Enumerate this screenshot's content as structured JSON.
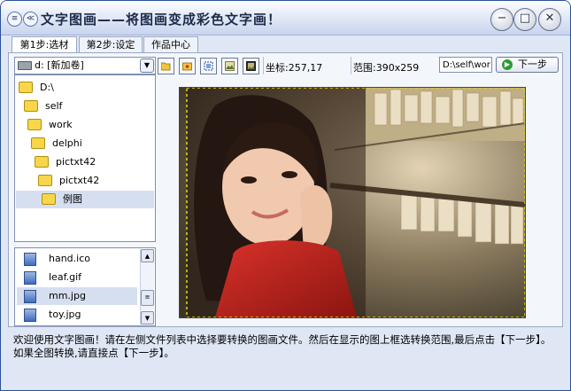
{
  "window": {
    "title": "文字图画——将图画变成彩色文字画！",
    "menu_icon": "≡",
    "collapse_icon": "≪",
    "minimize_icon": "−",
    "maximize_icon": "□",
    "close_icon": "✕"
  },
  "tabs": [
    {
      "label": "第1步:选材",
      "active": true
    },
    {
      "label": "第2步:设定",
      "active": false
    },
    {
      "label": "作品中心",
      "active": false
    }
  ],
  "drive": {
    "label": "d: [新加卷]",
    "dropdown_icon": "chevron-down-icon"
  },
  "tree": [
    {
      "label": "D:\\"
    },
    {
      "label": "self"
    },
    {
      "label": "work"
    },
    {
      "label": "delphi"
    },
    {
      "label": "pictxt42"
    },
    {
      "label": "pictxt42"
    },
    {
      "label": "例图",
      "selected": true
    }
  ],
  "files": [
    {
      "label": "hand.ico"
    },
    {
      "label": "leaf.gif"
    },
    {
      "label": "mm.jpg",
      "selected": true
    },
    {
      "label": "toy.jpg"
    }
  ],
  "toolbar": {
    "icons": [
      "open-folder-icon",
      "folder-star-icon",
      "fit-icon",
      "image-icon",
      "image-frame-icon"
    ],
    "coords": "坐标:257,17",
    "range": "范围:390x259",
    "path": "D:\\self\\wor",
    "next_label": "下一步"
  },
  "hint": "欢迎使用文字图画！请在左侧文件列表中选择要转换的图画文件。然后在显示的图上框选转换范围,最后点击【下一步】。如果全图转换,请直接点【下一步】。",
  "colors": {
    "window_bg": "#dfe7f5",
    "selection": "#d6dff0",
    "accent_green": "#2d9b35"
  }
}
